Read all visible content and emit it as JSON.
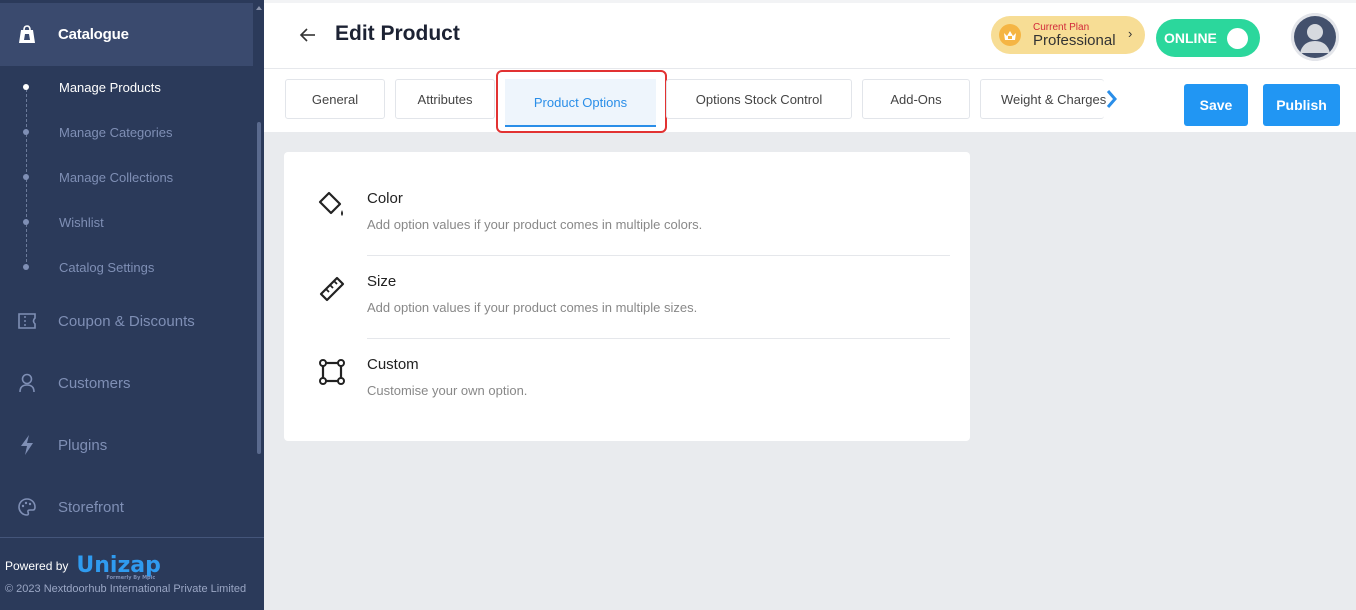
{
  "sidebar": {
    "section_title": "Catalogue",
    "sub_items": [
      {
        "label": "Manage Products",
        "active": true
      },
      {
        "label": "Manage Categories",
        "active": false
      },
      {
        "label": "Manage Collections",
        "active": false
      },
      {
        "label": "Wishlist",
        "active": false
      },
      {
        "label": "Catalog Settings",
        "active": false
      }
    ],
    "items": [
      {
        "label": "Coupon & Discounts",
        "icon": "ticket-icon"
      },
      {
        "label": "Customers",
        "icon": "user-icon"
      },
      {
        "label": "Plugins",
        "icon": "lightning-icon"
      },
      {
        "label": "Storefront",
        "icon": "palette-icon"
      }
    ],
    "footer": {
      "powered_by": "Powered by",
      "logo": "Unizap",
      "logo_sub": "Formerly By Mpic",
      "copyright": "© 2023 Nextdoorhub International Private Limited"
    }
  },
  "header": {
    "title": "Edit Product",
    "plan_label": "Current Plan",
    "plan_name": "Professional",
    "status": "ONLINE"
  },
  "tabs": {
    "items": [
      "General",
      "Attributes",
      "Product Options",
      "Options Stock Control",
      "Add-Ons",
      "Weight & Charges"
    ],
    "active": "Product Options",
    "save_label": "Save",
    "publish_label": "Publish"
  },
  "options": [
    {
      "title": "Color",
      "desc": "Add option values if your product comes in multiple colors.",
      "icon": "paint-bucket-icon"
    },
    {
      "title": "Size",
      "desc": "Add option values if your product comes in multiple sizes.",
      "icon": "ruler-icon"
    },
    {
      "title": "Custom",
      "desc": "Customise your own option.",
      "icon": "vector-square-icon"
    }
  ],
  "colors": {
    "sidebar_bg": "#2b3a5a",
    "accent": "#2196f3",
    "online": "#2bd79c",
    "highlight": "#e23232"
  }
}
